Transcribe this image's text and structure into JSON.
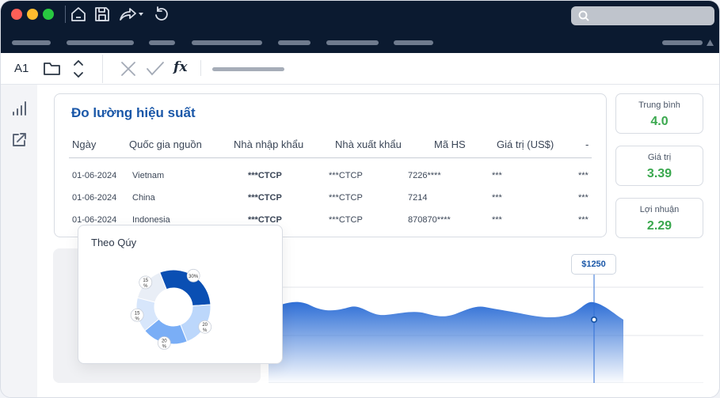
{
  "toolbar": {
    "home_icon": "home-icon",
    "save_icon": "save-icon",
    "share_icon": "share-icon",
    "undo_icon": "undo-icon"
  },
  "formula_bar": {
    "cell_ref": "A1",
    "fx_label": "fx"
  },
  "table": {
    "title": "Đo lường hiệu suất",
    "headers": [
      "Ngày",
      "Quốc gia nguồn",
      "Nhà nhập khẩu",
      "Nhà xuất khẩu",
      "Mã HS",
      "Giá trị (US$)",
      "-"
    ],
    "rows": [
      [
        "01-06-2024",
        "Vietnam",
        "***CTCP",
        "***CTCP",
        "7226****",
        "***",
        "***"
      ],
      [
        "01-06-2024",
        "China",
        "***CTCP",
        "***CTCP",
        "7214",
        "***",
        "***"
      ],
      [
        "01-06-2024",
        "Indonesia",
        "***CTCP",
        "***CTCP",
        "870870****",
        "***",
        "***"
      ]
    ]
  },
  "stats": [
    {
      "label": "Trung bình",
      "value": "4.0"
    },
    {
      "label": "Giá trị",
      "value": "3.39"
    },
    {
      "label": "Lợi nhuận",
      "value": "2.29"
    }
  ],
  "donut": {
    "title": "Theo Qúy",
    "segments": [
      {
        "label": "30%",
        "value": 30,
        "color": "#0a4fb3"
      },
      {
        "label": "20 %",
        "value": 20,
        "color": "#bcd7fb"
      },
      {
        "label": "20 %",
        "value": 20,
        "color": "#7aaef6"
      },
      {
        "label": "15 %",
        "value": 15,
        "color": "#d7e6fb"
      },
      {
        "label": "15 %",
        "value": 15,
        "color": "#e9eef6"
      }
    ]
  },
  "area_chart": {
    "tooltip": "$1250",
    "accent": "#2f6fd6"
  }
}
